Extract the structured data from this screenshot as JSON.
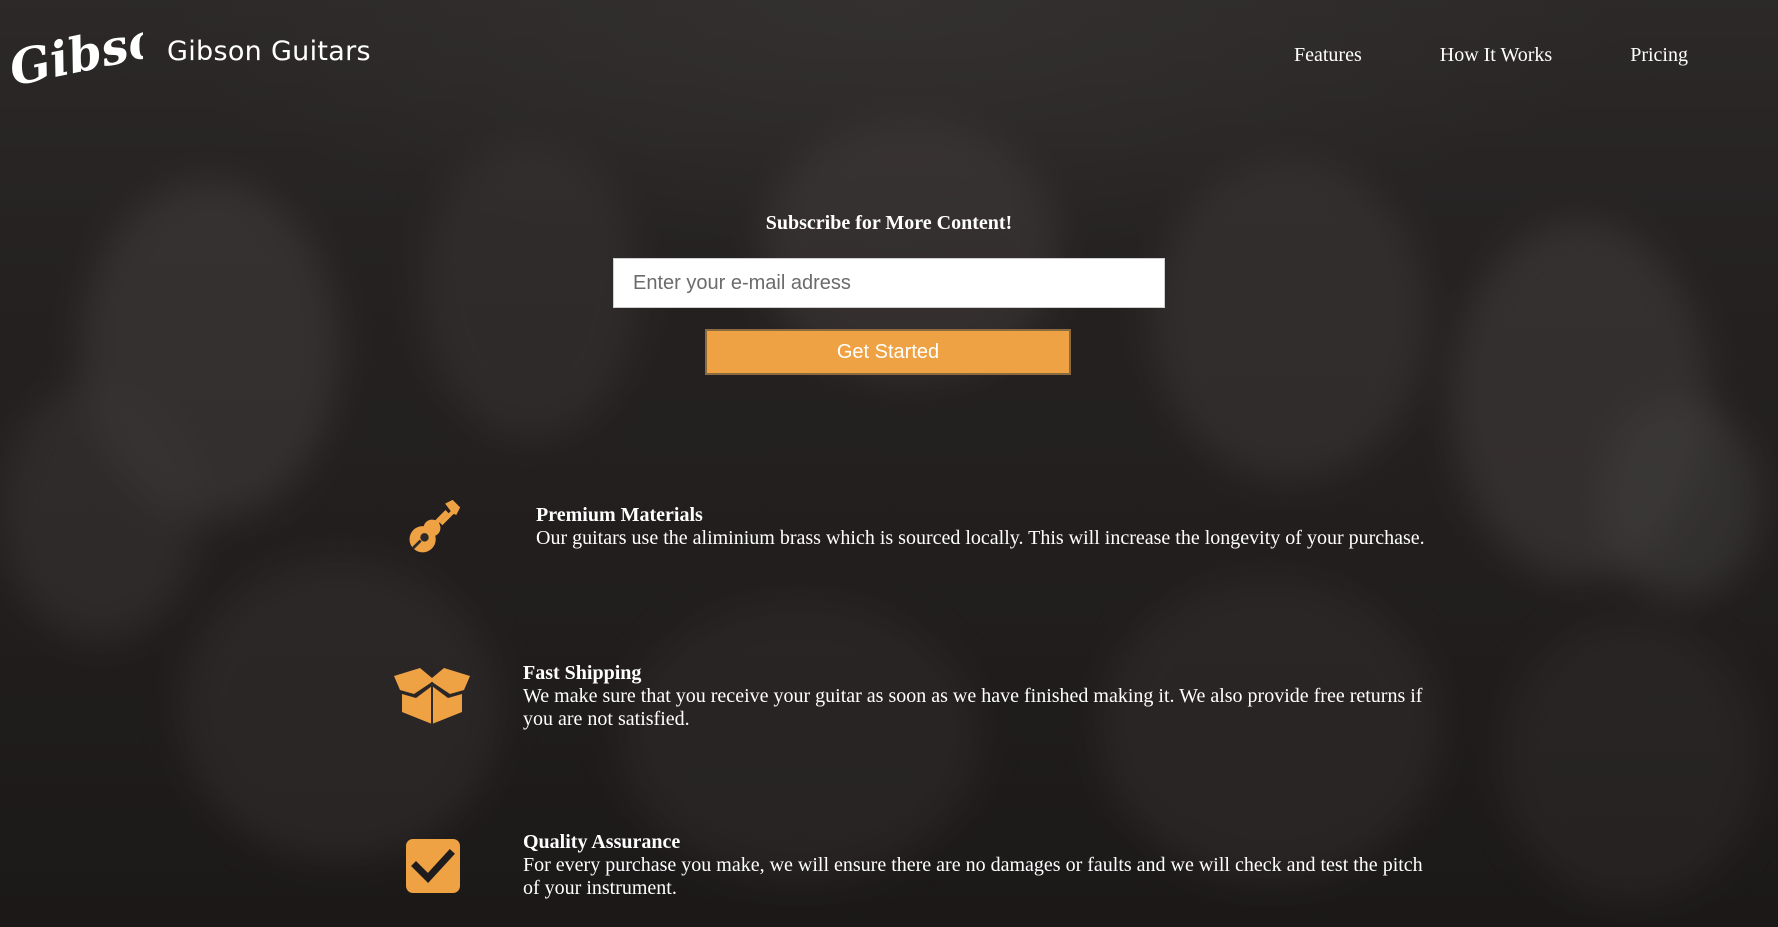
{
  "header": {
    "logo_text": "Gibson",
    "brand_name": "Gibson Guitars",
    "nav": [
      {
        "label": "Features"
      },
      {
        "label": "How It Works"
      },
      {
        "label": "Pricing"
      }
    ]
  },
  "subscribe": {
    "title": "Subscribe for More Content!",
    "email_placeholder": "Enter your e-mail adress",
    "button_label": "Get Started"
  },
  "features": [
    {
      "icon": "guitar-icon",
      "title": "Premium Materials",
      "description": "Our guitars use the aliminium brass which is sourced locally. This will increase the longevity of your purchase."
    },
    {
      "icon": "box-open-icon",
      "title": "Fast Shipping",
      "description": "We make sure that you receive your guitar as soon as we have finished making it. We also provide free returns if you are not satisfied."
    },
    {
      "icon": "check-square-icon",
      "title": "Quality Assurance",
      "description": "For every purchase you make, we will ensure there are no damages or faults and we will check and test the pitch of your instrument."
    }
  ],
  "colors": {
    "accent": "#eea244",
    "text": "#ffffff",
    "background": "#2a2727"
  }
}
